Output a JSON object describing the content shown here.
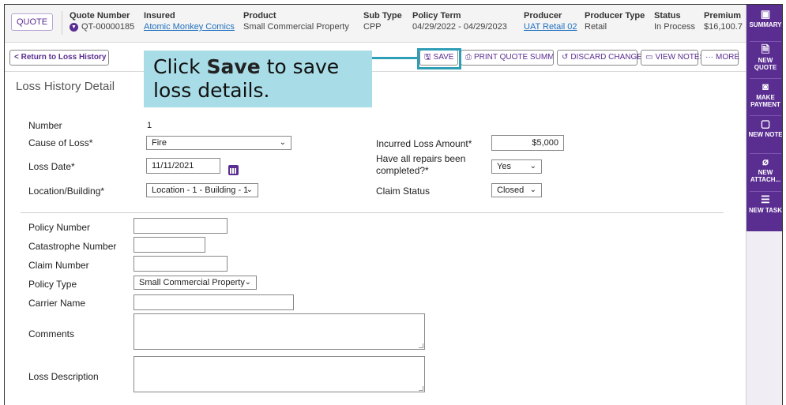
{
  "header": {
    "quote_badge": "QUOTE",
    "columns": [
      {
        "label": "Quote Number",
        "value": "QT-00000185"
      },
      {
        "label": "Insured",
        "value": "Atomic Monkey Comics"
      },
      {
        "label": "Product",
        "value": "Small Commercial Property"
      },
      {
        "label": "Sub Type",
        "value": "CPP"
      },
      {
        "label": "Policy Term",
        "value": "04/29/2022 - 04/29/2023"
      },
      {
        "label": "Producer",
        "value": "UAT Retail 02"
      },
      {
        "label": "Producer Type",
        "value": "Retail"
      },
      {
        "label": "Status",
        "value": "In Process"
      },
      {
        "label": "Premium",
        "value": "$16,100.7"
      }
    ]
  },
  "toolbar": {
    "back": "< Return to Loss History",
    "save": "SAVE",
    "print": "PRINT QUOTE SUMMA...",
    "discard": "DISCARD CHANGES",
    "notes": "VIEW NOTES",
    "more": "MORE"
  },
  "callout": {
    "pre": "Click ",
    "bold": "Save",
    "post": " to save",
    "line2": "loss details."
  },
  "panel": {
    "title": "Loss History Detail",
    "number_label": "Number",
    "number_value": "1",
    "cause_label": "Cause of Loss*",
    "cause_value": "Fire",
    "incurred_label": "Incurred Loss Amount*",
    "incurred_value": "$5,000",
    "loss_date_label": "Loss Date*",
    "loss_date_value": "11/11/2021",
    "repairs_label_1": "Have all repairs been",
    "repairs_label_2": "completed?*",
    "repairs_value": "Yes",
    "location_label": "Location/Building*",
    "location_value": "Location - 1 - Building - 1",
    "claim_status_label": "Claim Status",
    "claim_status_value": "Closed",
    "policy_number_label": "Policy Number",
    "catastrophe_label": "Catastrophe Number",
    "claim_number_label": "Claim Number",
    "policy_type_label": "Policy Type",
    "policy_type_value": "Small Commercial Property",
    "carrier_label": "Carrier Name",
    "comments_label": "Comments",
    "loss_desc_label": "Loss Description"
  },
  "rail": {
    "items": [
      {
        "label": "SUMMARY",
        "icon": "id-card-icon"
      },
      {
        "label": "NEW QUOTE",
        "icon": "document-plus-icon"
      },
      {
        "label": "MAKE PAYMENT",
        "icon": "payment-icon"
      },
      {
        "label": "NEW NOTE",
        "icon": "note-icon"
      },
      {
        "label": "NEW ATTACH...",
        "icon": "paperclip-icon"
      },
      {
        "label": "NEW TASK",
        "icon": "task-list-icon"
      }
    ]
  },
  "colors": {
    "brand": "#5a2d91",
    "highlight": "#2d9eb5",
    "callout_bg": "#a8dce6"
  }
}
